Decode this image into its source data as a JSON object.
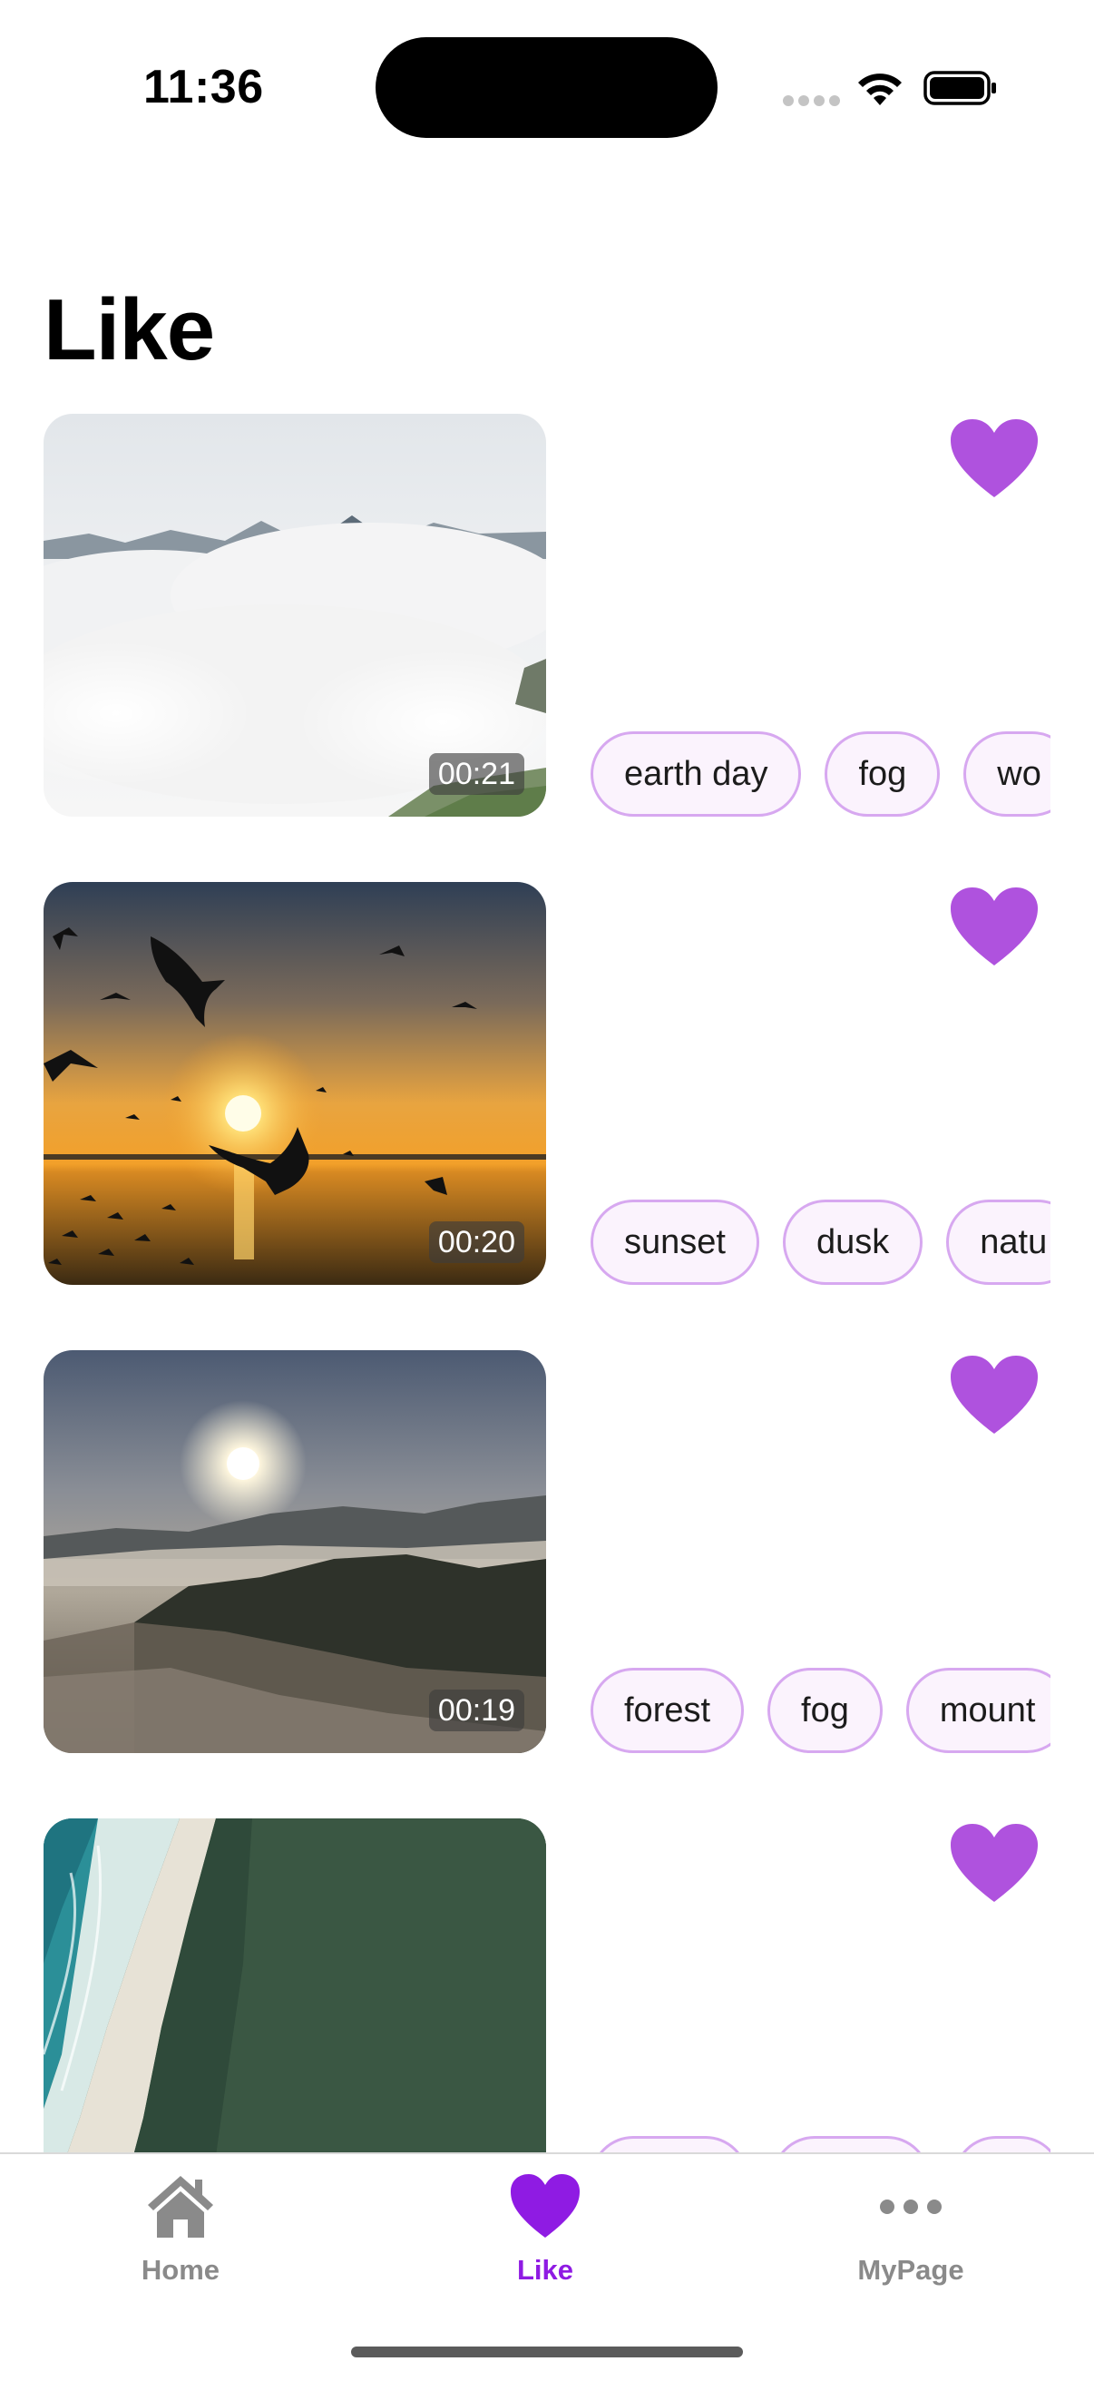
{
  "status_bar": {
    "time": "11:36",
    "icons": [
      "cellular-signal-icon",
      "wifi-icon",
      "battery-icon"
    ]
  },
  "page": {
    "title": "Like"
  },
  "colors": {
    "accent": "#8f1be3",
    "heart": "#af52de",
    "tag_border": "#d7a8f0",
    "tag_fill": "#fbf3fd",
    "inactive_tab": "#8a8a8a"
  },
  "videos": [
    {
      "scene": "fog-clouds-mountains",
      "duration": "00:21",
      "liked": true,
      "tags": [
        "earth day",
        "fog",
        "wo"
      ]
    },
    {
      "scene": "sunset-birds-sea",
      "duration": "00:20",
      "liked": true,
      "tags": [
        "sunset",
        "dusk",
        "natu"
      ]
    },
    {
      "scene": "sun-over-foggy-forest",
      "duration": "00:19",
      "liked": true,
      "tags": [
        "forest",
        "fog",
        "mount"
      ]
    },
    {
      "scene": "aerial-beach-coast",
      "duration": "",
      "liked": true,
      "tags": [
        "",
        "",
        ""
      ]
    }
  ],
  "tab_bar": {
    "tabs": [
      {
        "label": "Home",
        "icon": "house-icon",
        "active": false
      },
      {
        "label": "Like",
        "icon": "heart-icon",
        "active": true
      },
      {
        "label": "MyPage",
        "icon": "more-dots-icon",
        "active": false
      }
    ]
  }
}
